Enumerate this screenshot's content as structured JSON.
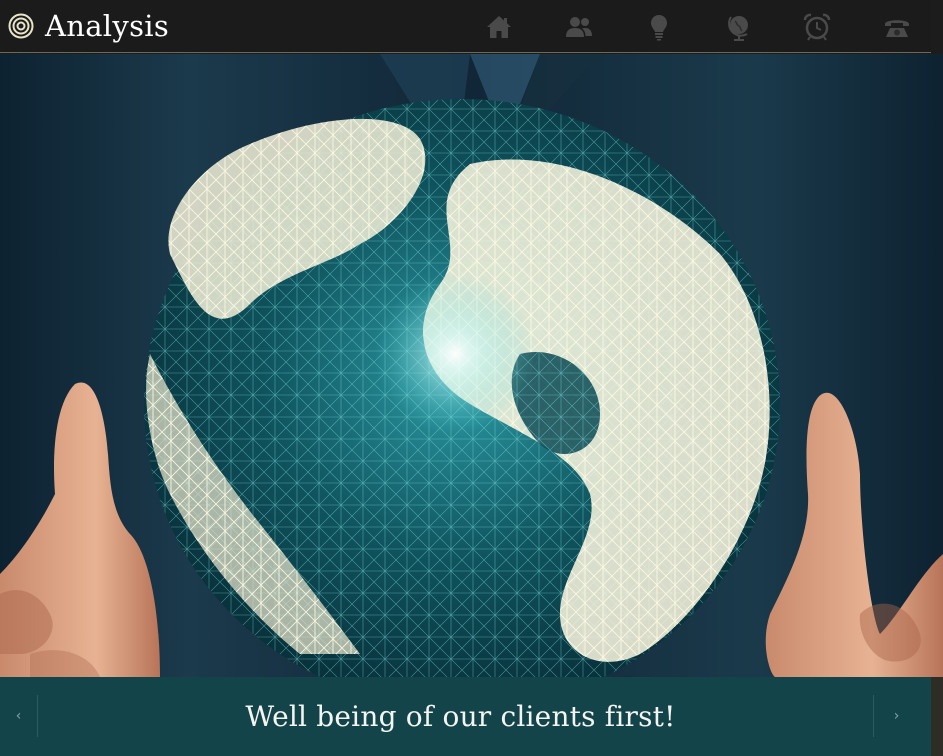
{
  "header": {
    "title": "Analysis",
    "brand_icon": "target-rings-icon",
    "nav": [
      {
        "icon": "home-icon"
      },
      {
        "icon": "users-icon"
      },
      {
        "icon": "lightbulb-icon"
      },
      {
        "icon": "globe-icon"
      },
      {
        "icon": "alarm-clock-icon"
      },
      {
        "icon": "telephone-icon"
      }
    ]
  },
  "slider": {
    "caption": "Well being of our clients first!",
    "prev_label": "‹",
    "next_label": "›"
  },
  "colors": {
    "header_bg": "#1b1b1b",
    "caption_bg": "#13444a",
    "nav_icon": "#4a4a4a"
  }
}
